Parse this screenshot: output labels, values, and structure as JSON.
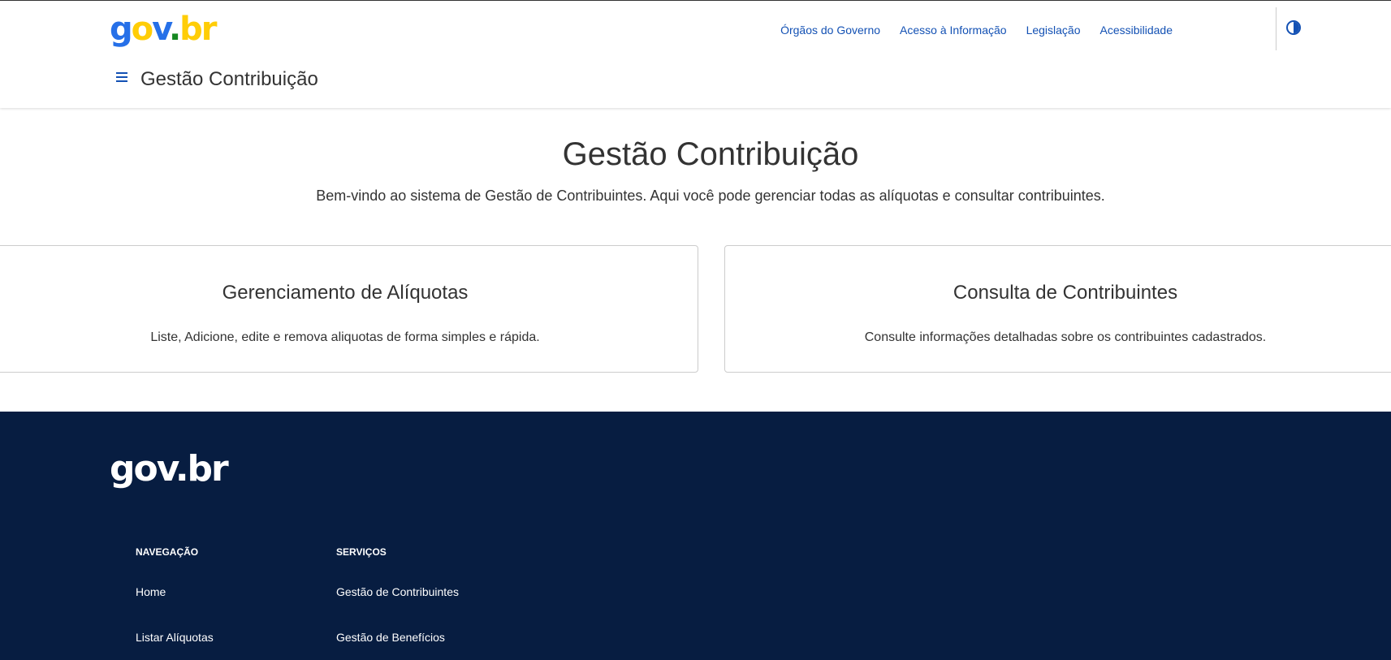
{
  "header": {
    "logo": {
      "g": "g",
      "o": "o",
      "v": "v",
      "dot": ".",
      "br": "br"
    },
    "top_links": [
      "Órgãos do Governo",
      "Acesso à Informação",
      "Legislação",
      "Acessibilidade"
    ],
    "contrast_icon": "contrast-icon",
    "menu_icon": "hamburger-menu-icon",
    "title": "Gestão Contribuição"
  },
  "main": {
    "title": "Gestão Contribuição",
    "subtitle": "Bem-vindo ao sistema de Gestão de Contribuintes. Aqui você pode gerenciar todas as alíquotas e consultar contribuintes.",
    "cards": [
      {
        "title": "Gerenciamento de Alíquotas",
        "description": "Liste, Adicione, edite e remova aliquotas de forma simples e rápida."
      },
      {
        "title": "Consulta de Contribuintes",
        "description": "Consulte informações detalhadas sobre os contribuintes cadastrados."
      }
    ]
  },
  "footer": {
    "logo": "gov.br",
    "columns": [
      {
        "title": "NAVEGAÇÃO",
        "links": [
          "Home",
          "Listar Alíquotas"
        ]
      },
      {
        "title": "SERVIÇOS",
        "links": [
          "Gestão de Contribuintes",
          "Gestão de Benefícios"
        ]
      }
    ]
  },
  "colors": {
    "primary_blue": "#1351b4",
    "footer_bg": "#071d41",
    "logo_blue": "#2670e8",
    "logo_yellow": "#ffcd07",
    "logo_green": "#168821"
  }
}
